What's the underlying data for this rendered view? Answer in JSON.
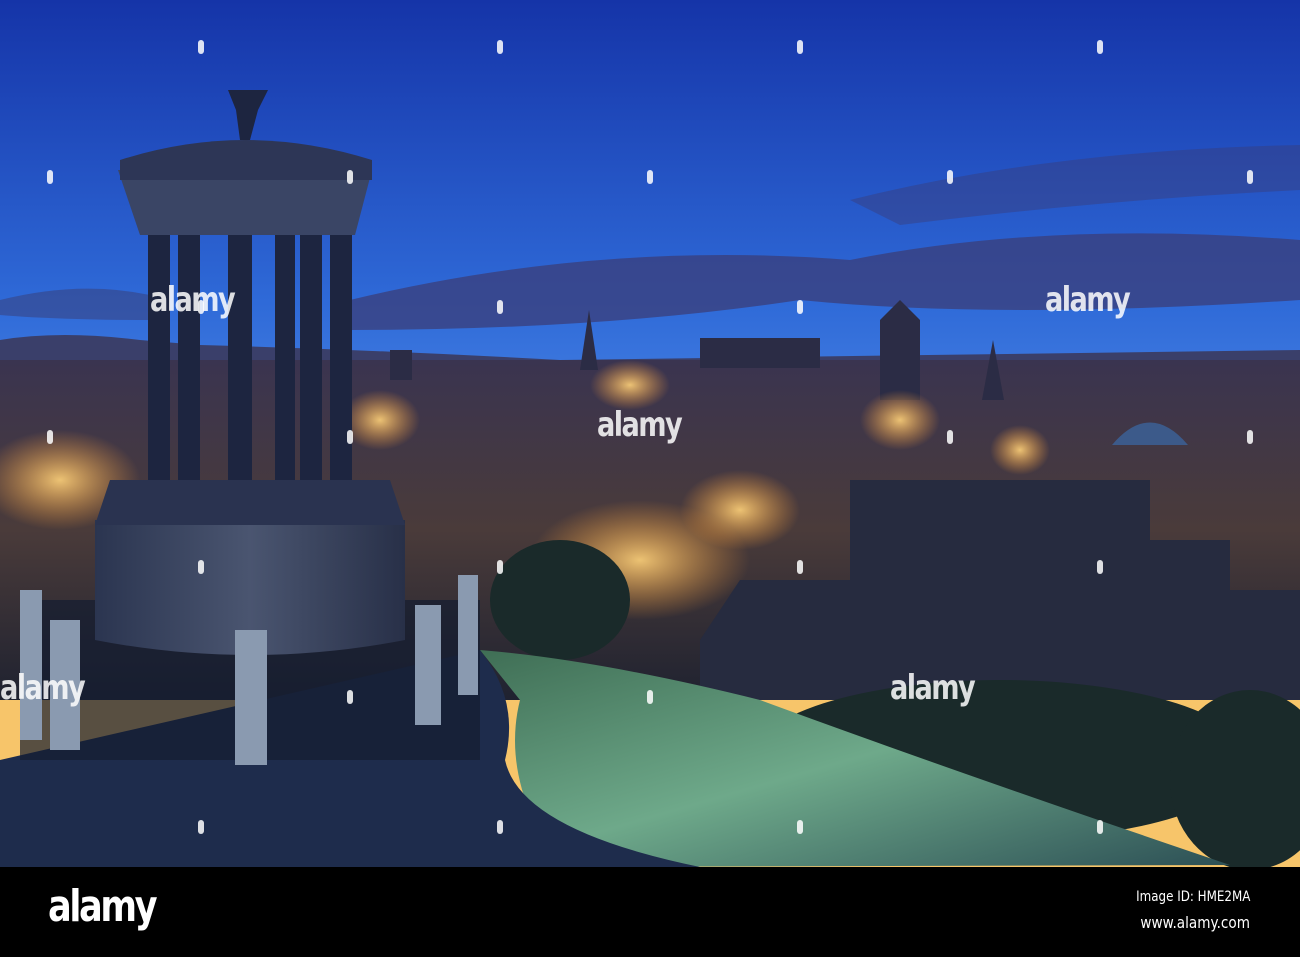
{
  "photo": {
    "colors": {
      "sky_top": "#1a3fb0",
      "sky_mid": "#3f7ee0",
      "horizon": "#f3a64a",
      "city_light": "#f5b545",
      "hill": "#5f9a7a",
      "path": "#1b2a4a"
    }
  },
  "watermark": {
    "text": "alamy"
  },
  "footer": {
    "logo": "alamy",
    "image_id": "Image ID: HME2MA",
    "website": "www.alamy.com"
  }
}
